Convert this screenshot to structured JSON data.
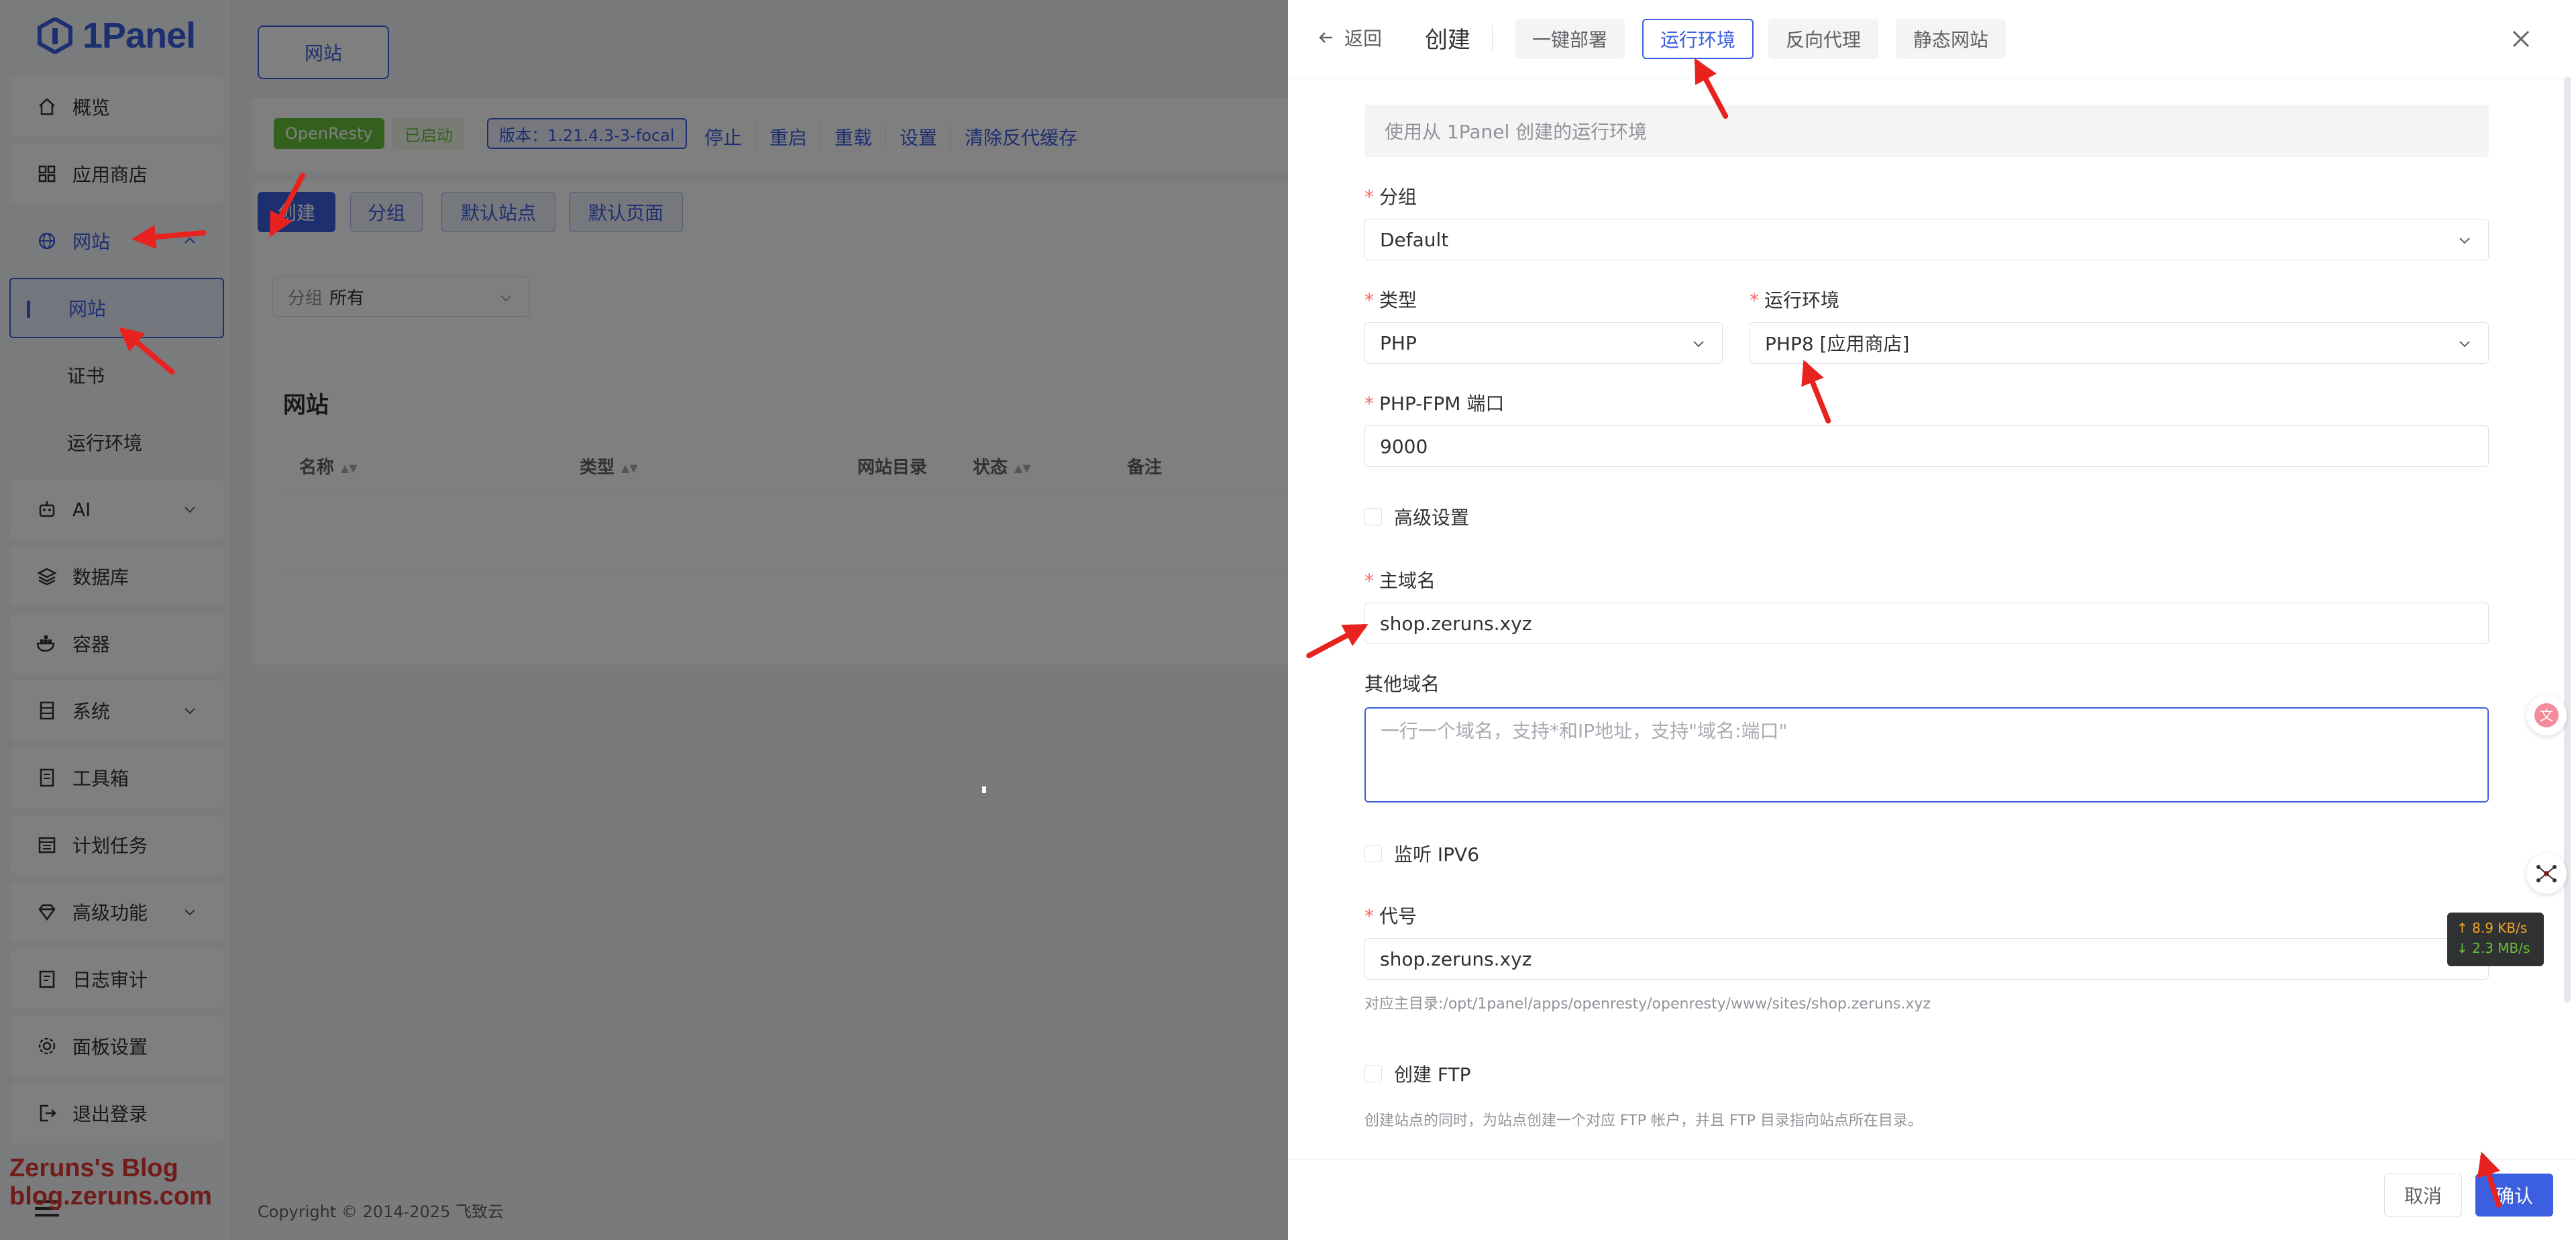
{
  "brand": {
    "name": "1Panel"
  },
  "sidebar": {
    "items": [
      {
        "label": "概览",
        "icon": "home-icon"
      },
      {
        "label": "应用商店",
        "icon": "grid-icon"
      },
      {
        "label": "网站",
        "icon": "globe-icon"
      },
      {
        "label": "AI",
        "icon": "robot-icon"
      },
      {
        "label": "数据库",
        "icon": "layers-icon"
      },
      {
        "label": "容器",
        "icon": "docker-icon"
      },
      {
        "label": "系统",
        "icon": "server-icon"
      },
      {
        "label": "工具箱",
        "icon": "toolbox-icon"
      },
      {
        "label": "计划任务",
        "icon": "calendar-icon"
      },
      {
        "label": "高级功能",
        "icon": "diamond-icon"
      },
      {
        "label": "日志审计",
        "icon": "log-icon"
      },
      {
        "label": "面板设置",
        "icon": "gear-icon"
      },
      {
        "label": "退出登录",
        "icon": "logout-icon"
      }
    ],
    "sub_items": [
      "网站",
      "证书",
      "运行环境"
    ]
  },
  "watermark": {
    "line1": "Zeruns's Blog",
    "line2": "blog.zeruns.com"
  },
  "main": {
    "top_tab": "网站",
    "status": {
      "server": "OpenResty",
      "state": "已启动",
      "version": "版本：1.21.4.3-3-focal"
    },
    "status_links": [
      "停止",
      "重启",
      "重载",
      "设置",
      "清除反代缓存"
    ],
    "actions": {
      "create": "创建",
      "group": "分组",
      "default_site": "默认站点",
      "default_page": "默认页面"
    },
    "filter": {
      "label": "分组",
      "value": "所有"
    },
    "list_title": "网站",
    "columns": [
      "名称",
      "类型",
      "网站目录",
      "状态",
      "备注"
    ],
    "footer": "Copyright © 2014-2025 飞致云"
  },
  "drawer": {
    "back": "返回",
    "title": "创建",
    "tabs": [
      "一键部署",
      "运行环境",
      "反向代理",
      "静态网站"
    ],
    "active_tab": 1,
    "notice": "使用从 1Panel 创建的运行环境",
    "fields": {
      "group": {
        "label": "分组",
        "value": "Default"
      },
      "type": {
        "label": "类型",
        "value": "PHP"
      },
      "runtime": {
        "label": "运行环境",
        "value": "PHP8 [应用商店]"
      },
      "fpm_port": {
        "label": "PHP-FPM 端口",
        "value": "9000"
      },
      "advanced": {
        "label": "高级设置"
      },
      "primary_domain": {
        "label": "主域名",
        "value": "shop.zeruns.xyz"
      },
      "other_domains": {
        "label": "其他域名",
        "placeholder": "一行一个域名，支持*和IP地址，支持\"域名:端口\""
      },
      "ipv6": {
        "label": "监听 IPV6"
      },
      "alias": {
        "label": "代号",
        "value": "shop.zeruns.xyz",
        "hint": "对应主目录:/opt/1panel/apps/openresty/openresty/www/sites/shop.zeruns.xyz"
      },
      "ftp": {
        "label": "创建 FTP",
        "hint": "创建站点的同时，为站点创建一个对应 FTP 帐户，并且 FTP 目录指向站点所在目录。"
      }
    },
    "cancel": "取消",
    "confirm": "确认"
  },
  "speed": {
    "up": "↑ 8.9 KB/s",
    "down": "↓ 2.3 MB/s"
  },
  "colors": {
    "accent": "#3c5fe0",
    "arrow": "#e8231f",
    "success": "#67c23a"
  }
}
